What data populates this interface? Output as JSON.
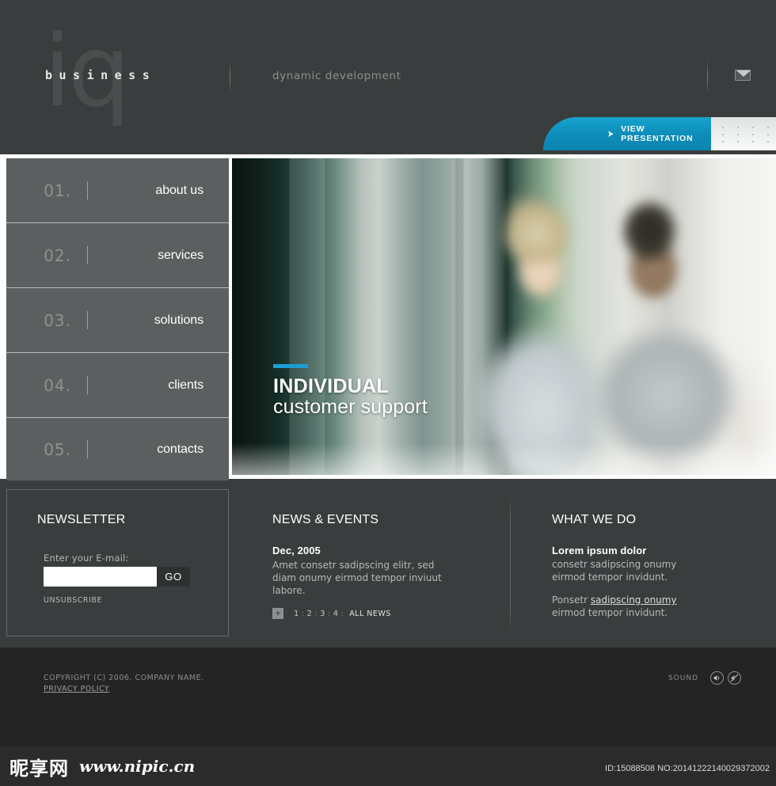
{
  "header": {
    "logo_mark": "iq",
    "logo_word": "business",
    "tagline": "dynamic development",
    "mail_icon": "envelope-icon",
    "presentation": {
      "arrow": "➤",
      "label": "VIEW PRESENTATION"
    }
  },
  "menu": {
    "items": [
      {
        "num": "01.",
        "label": "about us"
      },
      {
        "num": "02.",
        "label": "services"
      },
      {
        "num": "03.",
        "label": "solutions"
      },
      {
        "num": "04.",
        "label": "clients"
      },
      {
        "num": "05.",
        "label": "contacts"
      }
    ]
  },
  "hero": {
    "line1": "INDIVIDUAL",
    "line2": "customer support",
    "accent_color": "#1a9fd4"
  },
  "newsletter": {
    "title": "NEWSLETTER",
    "field_label": "Enter your E-mail:",
    "input_value": "",
    "input_placeholder": "",
    "go_label": "GO",
    "unsubscribe_label": "UNSUBSCRIBE"
  },
  "news": {
    "title": "NEWS & EVENTS",
    "date": "Dec, 2005",
    "body": "Amet consetr sadipscing elitr, sed diam onumy eirmod tempor inviuut labore.",
    "pager": {
      "plus": "+",
      "pages": [
        "1",
        "2",
        "3",
        "4"
      ],
      "separator": ":",
      "all_label": "ALL NEWS"
    }
  },
  "what_we_do": {
    "title": "WHAT WE DO",
    "heading": "Lorem ipsum dolor",
    "paragraph1": "consetr sadipscing onumy eirmod tempor invidunt.",
    "paragraph2_pre": "Ponsetr ",
    "paragraph2_link": "sadipscing onumy",
    "paragraph2_post": " eirmod tempor invidunt."
  },
  "footer": {
    "copyright": "COPYRIGHT (C) 2006.  COMPANY NAME.",
    "privacy": "PRIVACY POLICY",
    "sound_label": "SOUND",
    "sound_on_icon": "speaker-on-icon",
    "sound_off_icon": "speaker-muted-icon"
  },
  "watermark": {
    "site_cn": "昵享网",
    "site_url": "www.nipic.cn",
    "id_line": "ID:15088508 NO:20141222140029372002"
  }
}
